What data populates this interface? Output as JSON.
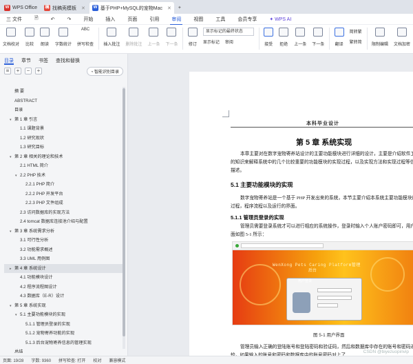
{
  "tabs": [
    {
      "label": "WPS Office",
      "icon": "wps-icon",
      "color": "#d9322c"
    },
    {
      "label": "找稿壳模板",
      "icon": "template-icon",
      "color": "#e5473a"
    },
    {
      "label": "基于PHP+MySQL的宠物Mac",
      "icon": "word-doc-icon",
      "color": "#2b5fd9"
    }
  ],
  "new_tab": "+",
  "menu": {
    "file": "三 文件",
    "items": [
      "开始",
      "插入",
      "页面",
      "引用",
      "审阅",
      "视图",
      "工具",
      "会员专享"
    ],
    "active": "审阅",
    "wps_ai": "WPS AI"
  },
  "ribbon": {
    "buttons": [
      "文档校对",
      "比较",
      "朗读",
      "字数统计",
      "拼写检查",
      "插入批注",
      "删除批注",
      "上一条",
      "下一条",
      "修订",
      "显示标记",
      "审阅",
      "接受",
      "拒绝",
      "上一条",
      "下一条",
      "翻译",
      "简转繁",
      "繁转简",
      "限制编辑",
      "文档加密"
    ],
    "markup_dropdown": "显示标记的最终状态",
    "markup_dropdown2": "显示标记",
    "abc_label": "ABC"
  },
  "nav": {
    "tabs": [
      "目录",
      "章节",
      "书签",
      "查找和替换"
    ],
    "active_tab": "目录",
    "smart_btn": "智能识别目录",
    "toc": [
      {
        "level": 0,
        "text": "摘  要",
        "caret": ""
      },
      {
        "level": 0,
        "text": "ABSTRACT",
        "caret": ""
      },
      {
        "level": 0,
        "text": "目录",
        "caret": ""
      },
      {
        "level": 0,
        "text": "第 1 章  引言",
        "caret": "▾"
      },
      {
        "level": 1,
        "text": "1.1  课题背景",
        "caret": ""
      },
      {
        "level": 1,
        "text": "1.2 研究现状",
        "caret": ""
      },
      {
        "level": 1,
        "text": "1.3 研究目标",
        "caret": ""
      },
      {
        "level": 0,
        "text": "第 2 章  相关的理论和技术",
        "caret": "▾"
      },
      {
        "level": 1,
        "text": "2.1 HTML  简介",
        "caret": ""
      },
      {
        "level": 1,
        "text": "2.2 PHP  技术",
        "caret": "▾"
      },
      {
        "level": 2,
        "text": "2.2.1 PHP 简介",
        "caret": ""
      },
      {
        "level": 2,
        "text": "2.2.2 PHP 开发平台",
        "caret": ""
      },
      {
        "level": 2,
        "text": "2.2.3 PHP 文件组成",
        "caret": ""
      },
      {
        "level": 1,
        "text": "2.3  访问数据库的实现方法",
        "caret": ""
      },
      {
        "level": 1,
        "text": "2.4 tomcat  数据库连接池介绍与配置",
        "caret": ""
      },
      {
        "level": 0,
        "text": "第 3 章  系统需求分析",
        "caret": "▾"
      },
      {
        "level": 1,
        "text": "3.1  可行性分析",
        "caret": ""
      },
      {
        "level": 1,
        "text": "3.2  功能需求概述",
        "caret": ""
      },
      {
        "level": 1,
        "text": "3.3 UML 用例图",
        "caret": ""
      },
      {
        "level": 0,
        "text": "第 4 章  系统设计",
        "caret": "▸",
        "selected": true
      },
      {
        "level": 1,
        "text": "4.1 功能模块设计",
        "caret": ""
      },
      {
        "level": 1,
        "text": "4.2  程序流程图设计",
        "caret": ""
      },
      {
        "level": 1,
        "text": "4.3  数据库（E-R）设计",
        "caret": ""
      },
      {
        "level": 0,
        "text": "第 5 章  系统实现",
        "caret": "▾"
      },
      {
        "level": 1,
        "text": "5.1  主要功能模块的实现",
        "caret": "▾"
      },
      {
        "level": 2,
        "text": "5.1.1  管理员登录的实现",
        "caret": ""
      },
      {
        "level": 2,
        "text": "5.1.2  宠物寄养功能的实现",
        "caret": ""
      },
      {
        "level": 2,
        "text": "5.1.3 后台宠物寄养信息的管理实现",
        "caret": ""
      },
      {
        "level": 0,
        "text": "总结",
        "caret": ""
      },
      {
        "level": 0,
        "text": "致  谢",
        "caret": ""
      }
    ]
  },
  "doc": {
    "header": "本科毕业设计",
    "chapter_title": "第 5 章  系统实现",
    "intro": "本章主要对在数字宠物寄养站设计的主要功能模块进行详细的设计，主要是介绍软件工程所学的知识来解释系统中的几个比较重要的功能模块的实现过程，以及实现方法和实现过程等信息进行描述。",
    "section": "5.1  主要功能模块的实现",
    "section_para": "数字宠物寄养站是一个基于 PHP 开发出来的系统，本节主要介绍本系统主要功能模块的实现过程，程序流程以及运行的界面。",
    "subsection": "5.1.1  管理员登录的实现",
    "sub_para": "管理员需要登录系统才可以进行相应的系统操作，登录时输入个人账户密码即可，用户登录界面如图 5-1 所示：",
    "figure_title": "WenXong Pets Caring Platform管理",
    "figure_title2": "后台",
    "login_title": "用户登录",
    "caption": "图 5-1  用户界面",
    "after_para": "管理员输入正确的登陆账号和登陆密码和验证码，然后和数据库中存在的账号和密码进行比较，如果输入的账号和密码和数据库中的账号密码对上了"
  },
  "status": {
    "page": "页面: 19/28",
    "words": "字数: 9360",
    "spell": "拼写检查: 打开",
    "proof": "校对",
    "compat": "兼容模式"
  },
  "watermark": "CSDN @biyezuopinvip"
}
